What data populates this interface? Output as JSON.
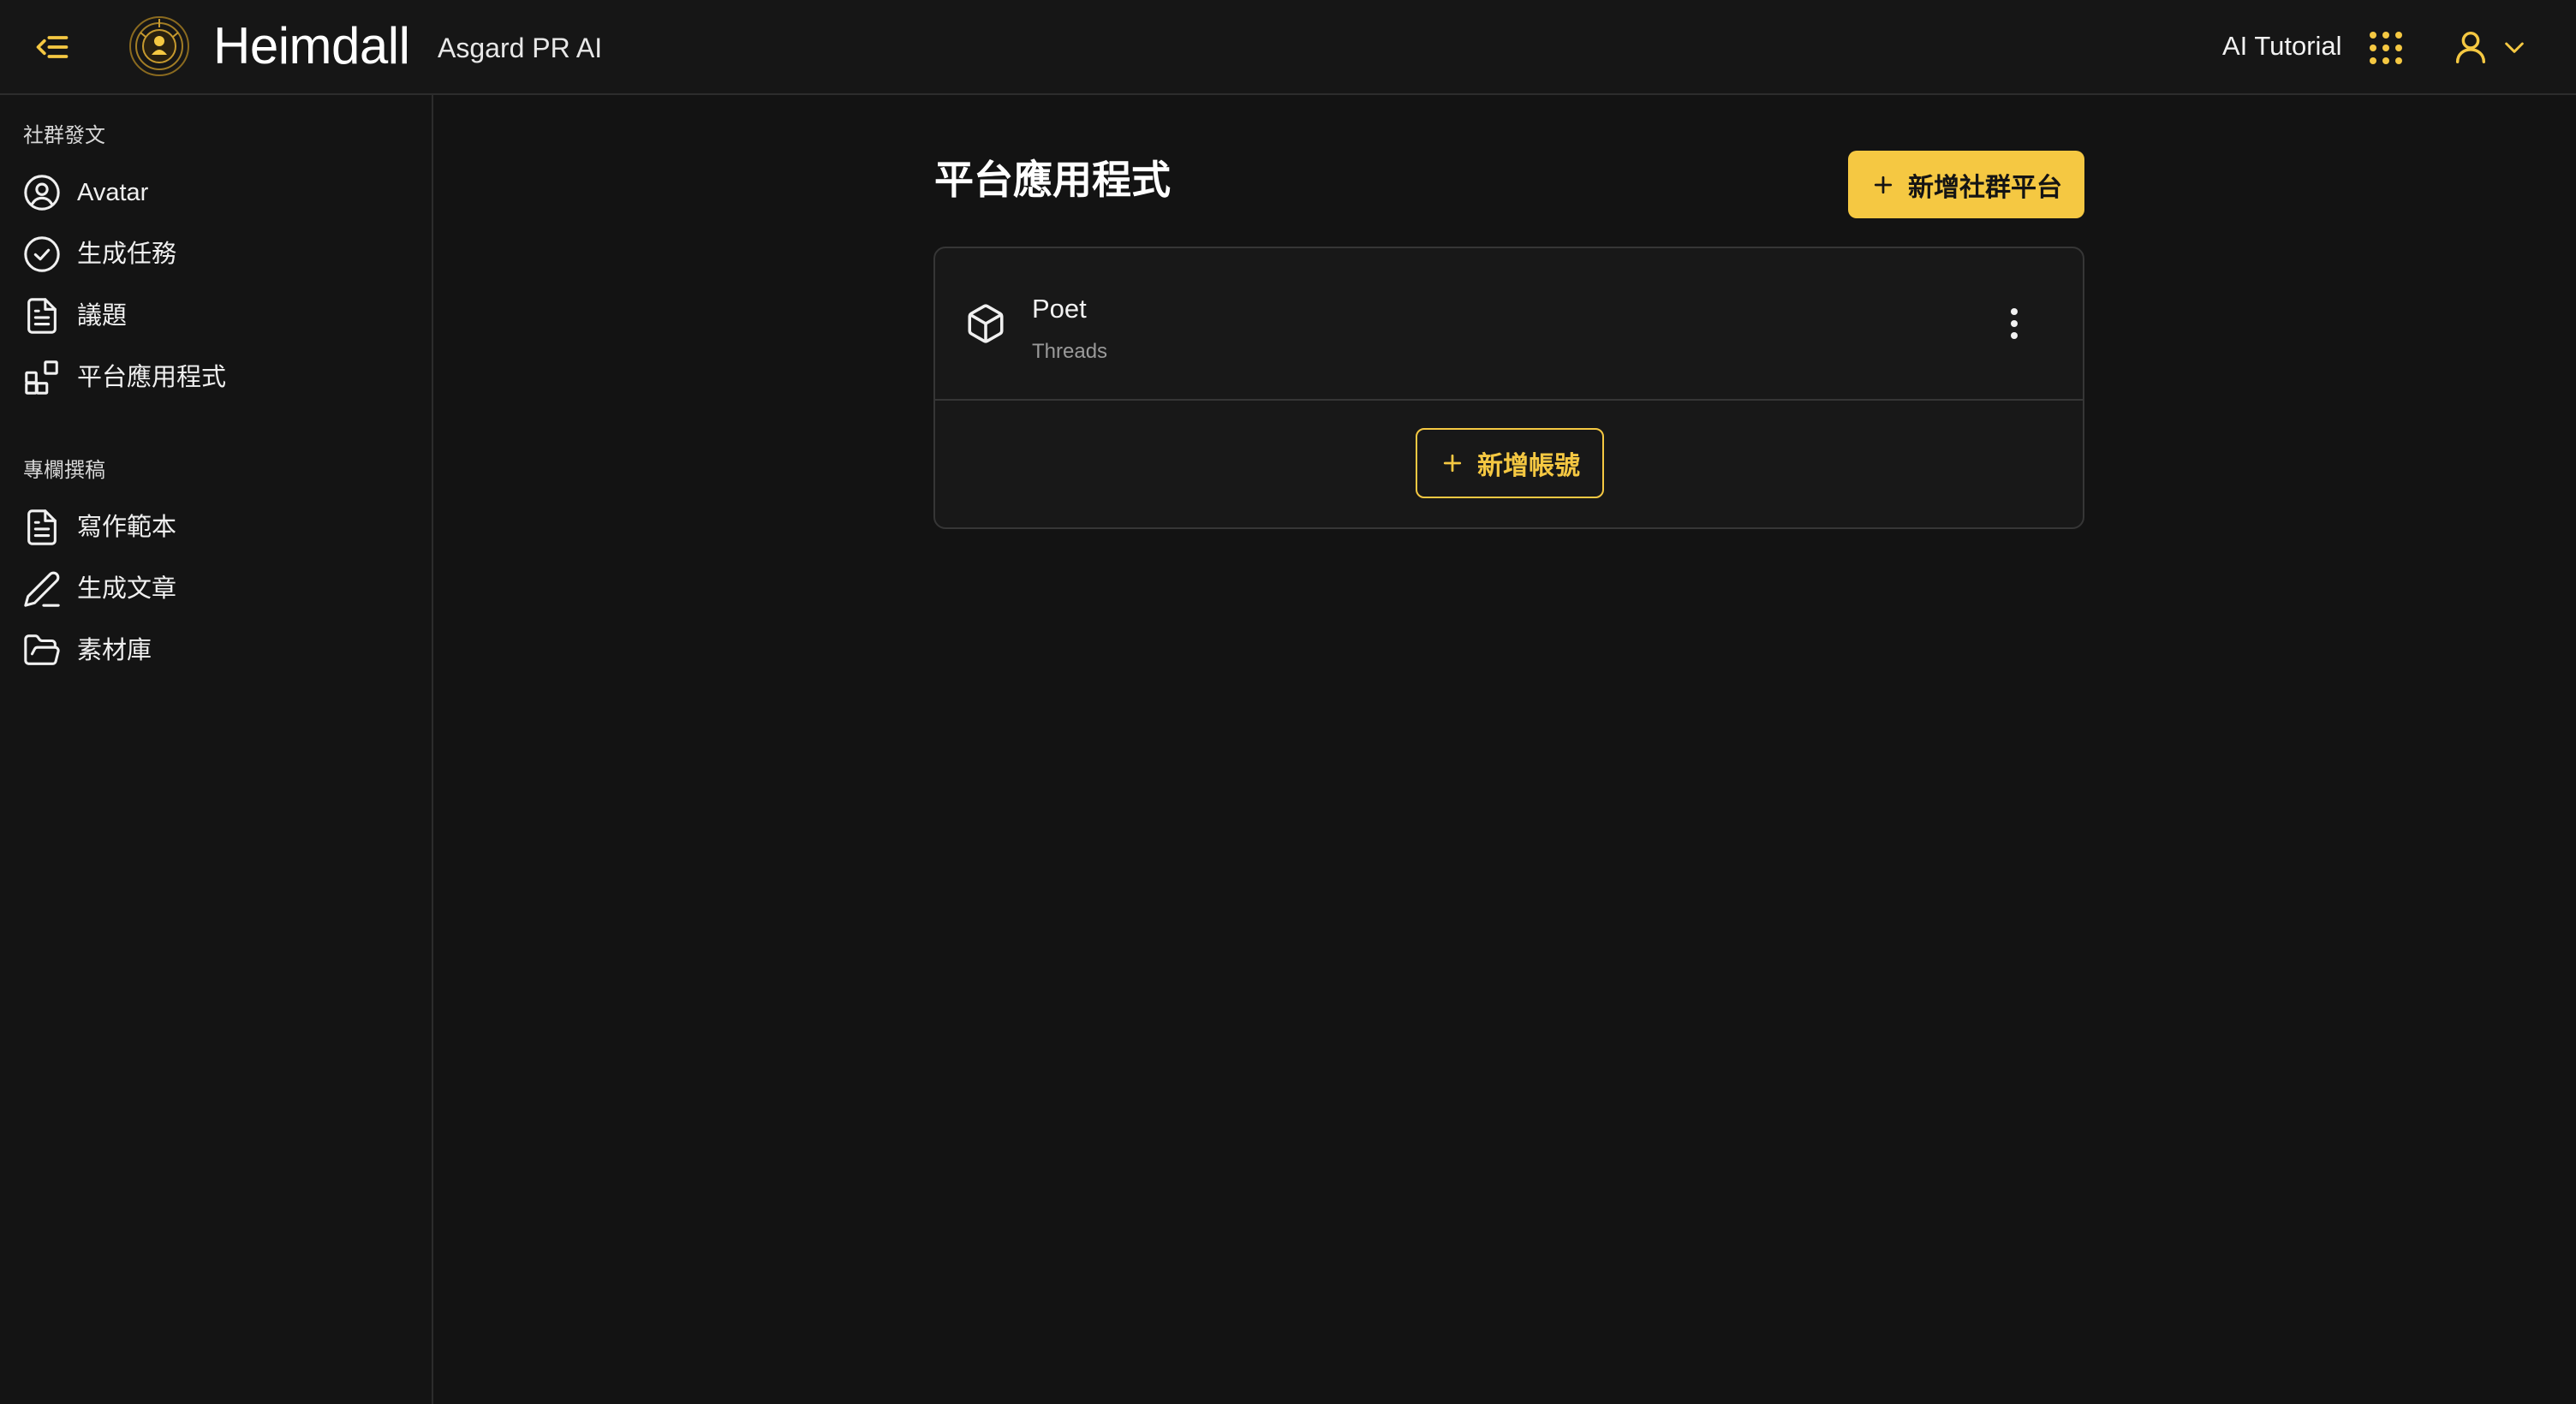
{
  "header": {
    "app_title": "Heimdall",
    "app_subtitle": "Asgard PR AI",
    "tutorial_label": "AI Tutorial",
    "accent_color": "#f5c842"
  },
  "sidebar": {
    "sections": [
      {
        "title": "社群發文",
        "items": [
          {
            "label": "Avatar",
            "icon": "user-circle-icon"
          },
          {
            "label": "生成任務",
            "icon": "check-circle-icon"
          },
          {
            "label": "議題",
            "icon": "document-icon"
          },
          {
            "label": "平台應用程式",
            "icon": "apps-icon"
          }
        ]
      },
      {
        "title": "專欄撰稿",
        "items": [
          {
            "label": "寫作範本",
            "icon": "document-icon"
          },
          {
            "label": "生成文章",
            "icon": "pencil-icon"
          },
          {
            "label": "素材庫",
            "icon": "folder-open-icon"
          }
        ]
      }
    ]
  },
  "main": {
    "page_title": "平台應用程式",
    "add_platform_label": "新增社群平台",
    "apps": [
      {
        "name": "Poet",
        "platform": "Threads",
        "icon": "cube-icon"
      }
    ],
    "add_account_label": "新增帳號"
  }
}
